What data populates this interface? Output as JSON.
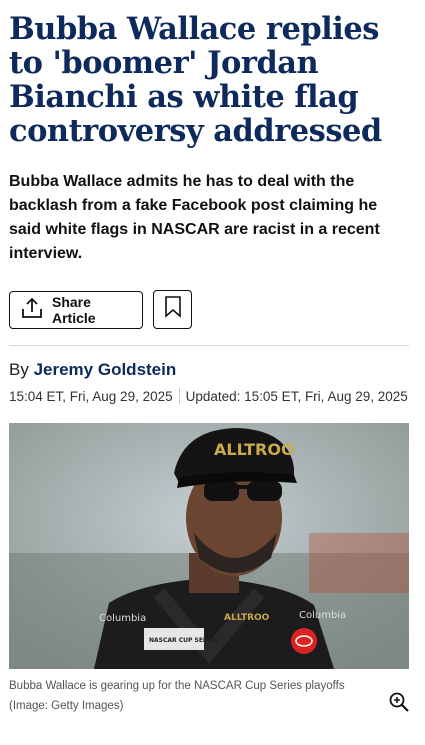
{
  "article": {
    "headline": "Bubba Wallace replies to 'boomer' Jordan Bianchi as white flag controversy addressed",
    "standfirst": "Bubba Wallace admits he has to deal with the backlash from a fake Facebook post claiming he said white flags in NASCAR are racist in a recent interview.",
    "share_label": "Share Article",
    "byline_prefix": "By",
    "author": "Jeremy Goldstein",
    "published": "15:04 ET, Fri, Aug 29, 2025",
    "updated": "Updated: 15:05 ET, Fri, Aug 29, 2025",
    "caption": "Bubba Wallace is gearing up for the NASCAR Cup Series playoffs",
    "credit": "(Image: Getty Images)",
    "hat_text": "ALLTROO",
    "suit_texts": [
      "Columbia",
      "Columbia",
      "ALLTROO",
      "NASCAR CUP SERIES"
    ]
  },
  "icons": {
    "share": "share-icon",
    "bookmark": "bookmark-icon",
    "zoom": "zoom-in-icon"
  },
  "colors": {
    "headline": "#0e2a5c",
    "author": "#0e2a5c"
  }
}
